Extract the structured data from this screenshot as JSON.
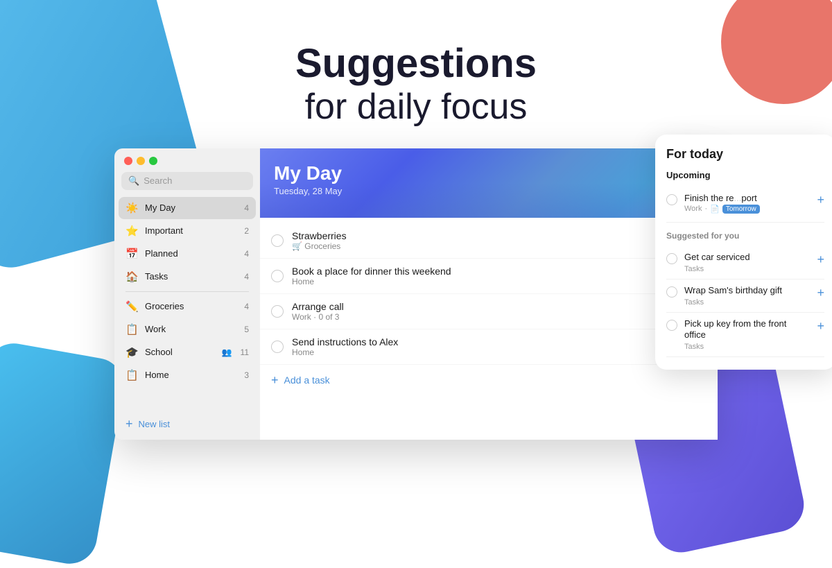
{
  "page": {
    "headline_line1": "Suggestions",
    "headline_line2": "for daily focus"
  },
  "sidebar": {
    "search_placeholder": "Search",
    "items": [
      {
        "id": "my-day",
        "icon": "☀️",
        "label": "My Day",
        "count": "4",
        "active": true
      },
      {
        "id": "important",
        "icon": "⭐",
        "label": "Important",
        "count": "2",
        "active": false
      },
      {
        "id": "planned",
        "icon": "📅",
        "label": "Planned",
        "count": "4",
        "active": false
      },
      {
        "id": "tasks",
        "icon": "🏠",
        "label": "Tasks",
        "count": "4",
        "active": false
      }
    ],
    "lists": [
      {
        "id": "groceries",
        "icon": "✏️",
        "label": "Groceries",
        "count": "4"
      },
      {
        "id": "work",
        "icon": "📋",
        "label": "Work",
        "count": "5"
      },
      {
        "id": "school",
        "icon": "🎓",
        "label": "School",
        "count": "11",
        "has_avatar": true
      },
      {
        "id": "home",
        "icon": "📋",
        "label": "Home",
        "count": "3"
      }
    ],
    "new_list_label": "New list"
  },
  "my_day": {
    "title": "My Day",
    "date": "Tuesday, 28 May",
    "icon": "☀️"
  },
  "tasks": [
    {
      "id": 1,
      "name": "Strawberries",
      "sub": "🛒 Groceries",
      "starred": false
    },
    {
      "id": 2,
      "name": "Book a place for dinner this weekend",
      "sub": "Home",
      "starred": false
    },
    {
      "id": 3,
      "name": "Arrange call",
      "sub": "Work · 0 of 3",
      "starred": false
    },
    {
      "id": 4,
      "name": "Send instructions to Alex",
      "sub": "Home",
      "starred": false
    }
  ],
  "add_task_label": "Add a task",
  "for_today": {
    "title": "For today",
    "upcoming_label": "Upcoming",
    "upcoming_item": {
      "name": "Finish the re...",
      "meta_list": "Work",
      "meta_icon": "📋",
      "meta_extra": "report",
      "meta_date": "Tomorrow"
    },
    "suggested_label": "Suggested for you",
    "suggestions": [
      {
        "id": 1,
        "name": "Get car serviced",
        "list": "Tasks"
      },
      {
        "id": 2,
        "name": "Wrap Sam's birthday gift",
        "list": "Tasks"
      },
      {
        "id": 3,
        "name": "Pick up key from the front office",
        "list": "Tasks"
      }
    ]
  }
}
